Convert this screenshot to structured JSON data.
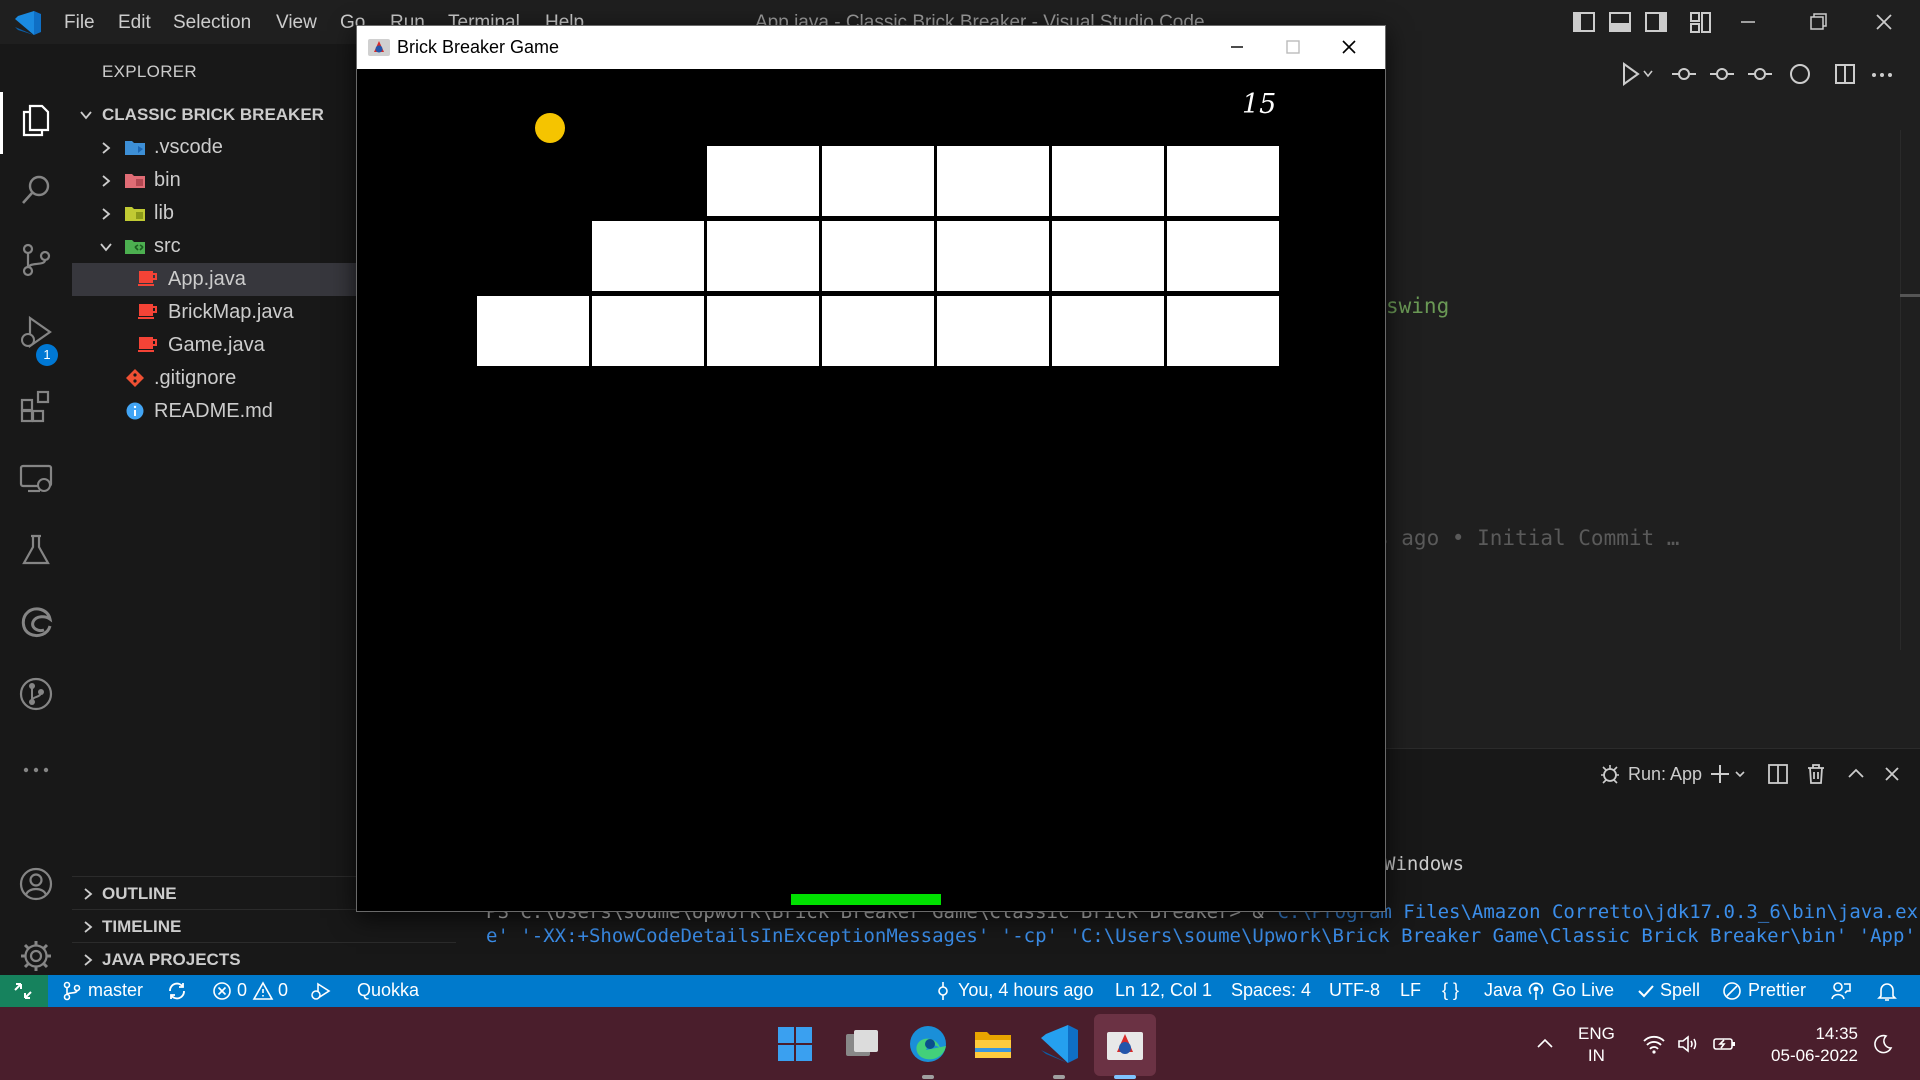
{
  "vscode": {
    "menu": [
      "File",
      "Edit",
      "Selection",
      "View",
      "Go",
      "Run",
      "Terminal",
      "Help"
    ],
    "window_title": "App.java - Classic Brick Breaker - Visual Studio Code",
    "debug_badge": "1"
  },
  "sidebar": {
    "title": "EXPLORER",
    "root": "CLASSIC BRICK BREAKER",
    "items": [
      {
        "label": ".vscode",
        "kind": "folder",
        "icon": "vscode-folder-icon"
      },
      {
        "label": "bin",
        "kind": "folder",
        "icon": "bin-folder-icon"
      },
      {
        "label": "lib",
        "kind": "folder",
        "icon": "lib-folder-icon"
      },
      {
        "label": "src",
        "kind": "folder-open",
        "icon": "src-folder-icon"
      },
      {
        "label": "App.java",
        "kind": "file",
        "icon": "java-file-icon"
      },
      {
        "label": "BrickMap.java",
        "kind": "file",
        "icon": "java-file-icon"
      },
      {
        "label": "Game.java",
        "kind": "file",
        "icon": "java-file-icon"
      },
      {
        "label": ".gitignore",
        "kind": "file",
        "icon": "git-file-icon"
      },
      {
        "label": "README.md",
        "kind": "file",
        "icon": "info-file-icon"
      }
    ],
    "sections": [
      "OUTLINE",
      "TIMELINE",
      "JAVA PROJECTS"
    ]
  },
  "editor": {
    "code_fragment_1": "swing",
    "blame_fragment": "s ago • Initial Commit …"
  },
  "panel": {
    "run_label": "Run: App",
    "terminal_fragment_1": "Windows",
    "terminal_line_1_left": "PS C:\\Users\\soume\\Upwork\\Brick Breaker Game\\Classic Brick Breaker> &",
    "terminal_line_1_right": "'C:\\Program Files\\Amazon Corretto\\jdk17.0.3_6\\bin\\java.ex",
    "terminal_line_2": "e' '-XX:+ShowCodeDetailsInExceptionMessages' '-cp' 'C:\\Users\\soume\\Upwork\\Brick Breaker Game\\Classic Brick Breaker\\bin' 'App'"
  },
  "statusbar": {
    "branch": "master",
    "errors": "0",
    "warnings": "0",
    "quokka": "Quokka",
    "blame": "You, 4 hours ago",
    "cursor": "Ln 12, Col 1",
    "spaces": "Spaces: 4",
    "encoding": "UTF-8",
    "eol": "LF",
    "language": "Java",
    "go_live": "Go Live",
    "spell": "Spell",
    "prettier": "Prettier"
  },
  "taskbar": {
    "lang_line1": "ENG",
    "lang_line2": "IN",
    "time": "14:35",
    "date": "05-06-2022"
  },
  "game": {
    "title": "Brick Breaker Game",
    "score": "15",
    "ball_color": "#f5c400",
    "paddle_color": "#00e000",
    "brick_grid": [
      [
        0,
        0,
        1,
        1,
        1,
        1,
        1
      ],
      [
        0,
        1,
        1,
        1,
        1,
        1,
        1
      ],
      [
        1,
        1,
        1,
        1,
        1,
        1,
        1
      ]
    ]
  }
}
